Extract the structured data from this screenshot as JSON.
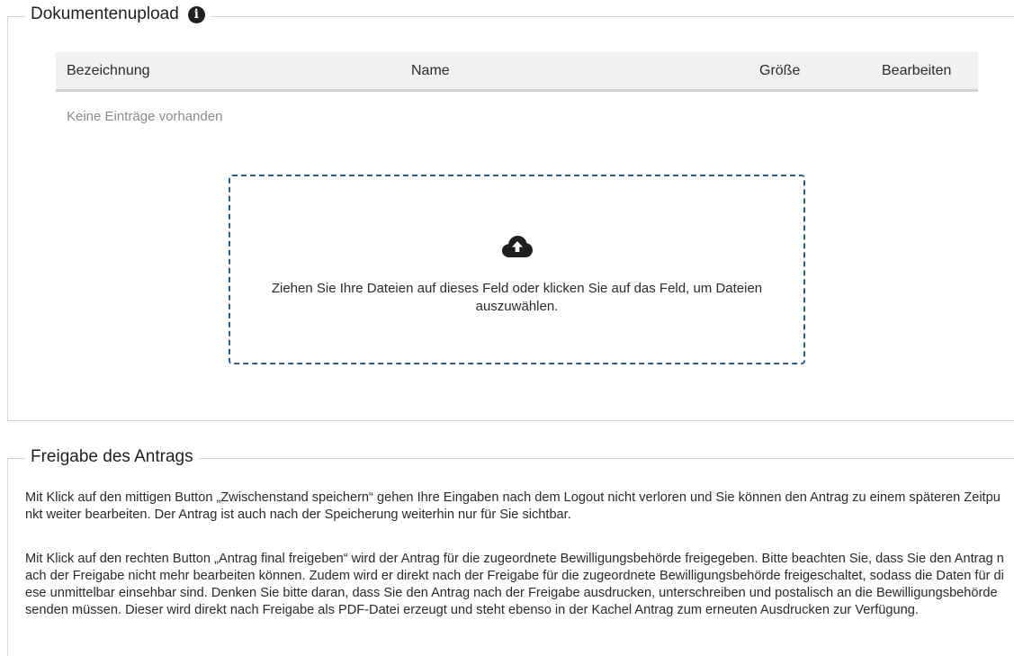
{
  "upload_section": {
    "title": "Dokumentenupload",
    "info_icon": "info-circle-icon",
    "table": {
      "columns": [
        "Bezeichnung",
        "Name",
        "Größe",
        "Bearbeiten"
      ],
      "rows": [],
      "empty_text": "Keine Einträge vorhanden"
    },
    "dropzone": {
      "icon": "cloud-upload-icon",
      "text": "Ziehen Sie Ihre Dateien auf dieses Feld oder klicken Sie auf das Feld, um Dateien auszuwählen.",
      "border_color": "#2c5f84"
    }
  },
  "release_section": {
    "title": "Freigabe des Antrags",
    "paragraphs": [
      "Mit Klick auf den mittigen Button „Zwischenstand speichern“ gehen Ihre Eingaben nach dem Logout nicht verloren und Sie können den Antrag zu einem späteren Zeitpunkt weiter bearbeiten. Der Antrag ist auch nach der Speicherung weiterhin nur für Sie sichtbar.",
      "Mit Klick auf den rechten Button „Antrag final freigeben“ wird der Antrag für die zugeordnete Bewilligungsbehörde freigegeben. Bitte beachten Sie, dass Sie den Antrag nach der Freigabe nicht mehr bearbeiten können. Zudem wird er direkt nach der Freigabe für die zugeordnete Bewilligungsbehörde freigeschaltet, sodass die Daten für diese unmittelbar einsehbar sind. Denken Sie bitte daran, dass Sie den Antrag nach der Freigabe ausdrucken, unterschreiben und postalisch an die Bewilligungsbehörde senden müssen. Dieser wird direkt nach Freigabe als PDF-Datei erzeugt und steht ebenso in der Kachel Antrag zum erneuten Ausdrucken zur Verfügung."
    ]
  }
}
